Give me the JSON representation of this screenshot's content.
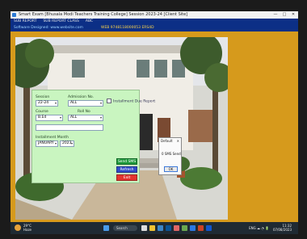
{
  "window": {
    "title": "Smart Exam [Bhusala Modi Teachers Training College] Session 2023-24 [Client Site]",
    "buttons": [
      "—",
      "□",
      "✕"
    ]
  },
  "menu": {
    "items": [
      "SUB REPORT",
      "SUB REPORT CLASS",
      "ABC"
    ]
  },
  "infobar": {
    "left": "Software Designed: www.website.com",
    "right": "WEB 9748118000053 ERS4D"
  },
  "form": {
    "session_label": "Session",
    "session_value": "22-24",
    "admission_label": "Admission No.",
    "admission_value": "ALL",
    "checkbox_label": "Installment Due Report",
    "course_label": "Course",
    "course_value": "B.Ed",
    "rollno_label": "Roll No",
    "rollno_value": "ALL",
    "installment_label": "Installment Month",
    "month_value": "JANUARY",
    "year_value": "2023",
    "buttons": {
      "send": "Send SMS",
      "refresh": "Refresh",
      "exit": "Exit"
    }
  },
  "dialog": {
    "title": "Default",
    "message": "0 SMS Send",
    "ok": "OK"
  },
  "taskbar": {
    "weather_temp": "29°C",
    "weather_desc": "Haze",
    "search": "Search",
    "tray_icons": "ENG ☁ ◔ 🔋",
    "time": "11:32",
    "date": "07/08/2023"
  },
  "colors": {
    "menubar": "#0c2f86",
    "desktop": "#d69a1c",
    "form": "#c9f5c0",
    "send_button": "#1e9a3c",
    "refresh_button": "#2f4bc8",
    "exit_button": "#e3342f"
  }
}
